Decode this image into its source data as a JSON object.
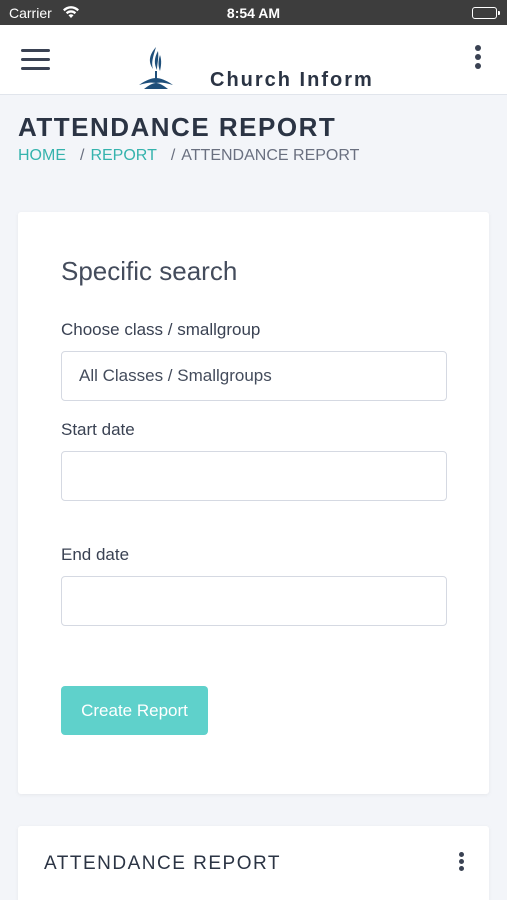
{
  "status_bar": {
    "carrier": "Carrier",
    "time": "8:54 AM",
    "wifi_icon": "wifi-icon",
    "battery_icon": "battery-icon"
  },
  "header": {
    "menu_icon": "hamburger-menu-icon",
    "logo_icon": "church-flame-logo",
    "brand": "Church Inform",
    "more_icon": "vertical-dots-icon"
  },
  "page": {
    "title": "ATTENDANCE REPORT",
    "breadcrumb": {
      "home": "HOME",
      "report": "REPORT",
      "current": "ATTENDANCE REPORT"
    }
  },
  "search_card": {
    "title": "Specific search",
    "class_label": "Choose class / smallgroup",
    "class_value": "All Classes / Smallgroups",
    "start_label": "Start date",
    "start_value": "",
    "end_label": "End date",
    "end_value": "",
    "submit_label": "Create Report"
  },
  "report_card": {
    "title": "ATTENDANCE REPORT"
  },
  "colors": {
    "accent": "#35b3ad",
    "button": "#5fd1cb",
    "background": "#f3f5f9"
  }
}
